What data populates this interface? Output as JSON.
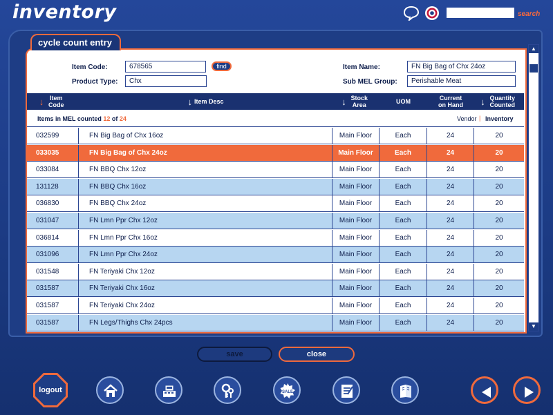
{
  "app": {
    "title": "inventory",
    "search": {
      "value": "",
      "link_label": "search"
    },
    "icons": [
      "help-bubble-icon",
      "target-icon"
    ]
  },
  "panel": {
    "tab_label": "cycle count entry"
  },
  "form": {
    "item_code_label": "Item Code:",
    "item_code_value": "678565",
    "find_label": "find",
    "product_type_label": "Product Type:",
    "product_type_value": "Chx",
    "item_name_label": "Item Name:",
    "item_name_value": "FN Big Bag of Chx 24oz",
    "sub_mel_group_label": "Sub MEL Group:",
    "sub_mel_group_value": "Perishable Meat"
  },
  "table": {
    "headers": {
      "item_code": "Item Code",
      "item_desc": "Item Desc",
      "stock_area": "Stock Area",
      "uom": "UOM",
      "current_on_hand": "Current on Hand",
      "quantity_counted": "Quantity Counted"
    },
    "summary": {
      "prefix": "Items in MEL counted",
      "counted": "12",
      "of_word": "of",
      "total": "24"
    },
    "toggle": {
      "vendor": "Vendor",
      "separator": "|",
      "inventory": "Inventory"
    },
    "rows": [
      {
        "code": "032599",
        "desc": "FN Big Bag of Chx 16oz",
        "area": "Main Floor",
        "uom": "Each",
        "on_hand": "24",
        "counted": "20",
        "style": "white"
      },
      {
        "code": "033035",
        "desc": "FN Big Bag of Chx 24oz",
        "area": "Main Floor",
        "uom": "Each",
        "on_hand": "24",
        "counted": "20",
        "style": "selected"
      },
      {
        "code": "033084",
        "desc": "FN BBQ Chx 12oz",
        "area": "Main Floor",
        "uom": "Each",
        "on_hand": "24",
        "counted": "20",
        "style": "white"
      },
      {
        "code": "131128",
        "desc": "FN BBQ Chx 16oz",
        "area": "Main Floor",
        "uom": "Each",
        "on_hand": "24",
        "counted": "20",
        "style": "blue"
      },
      {
        "code": "036830",
        "desc": "FN BBQ Chx 24oz",
        "area": "Main Floor",
        "uom": "Each",
        "on_hand": "24",
        "counted": "20",
        "style": "white"
      },
      {
        "code": "031047",
        "desc": "FN Lmn Ppr Chx 12oz",
        "area": "Main Floor",
        "uom": "Each",
        "on_hand": "24",
        "counted": "20",
        "style": "blue"
      },
      {
        "code": "036814",
        "desc": "FN Lmn Ppr Chx 16oz",
        "area": "Main Floor",
        "uom": "Each",
        "on_hand": "24",
        "counted": "20",
        "style": "white"
      },
      {
        "code": "031096",
        "desc": "FN Lmn Ppr Chx 24oz",
        "area": "Main Floor",
        "uom": "Each",
        "on_hand": "24",
        "counted": "20",
        "style": "blue"
      },
      {
        "code": "031548",
        "desc": "FN Teriyaki Chx 12oz",
        "area": "Main Floor",
        "uom": "Each",
        "on_hand": "24",
        "counted": "20",
        "style": "white"
      },
      {
        "code": "031587",
        "desc": "FN Teriyaki Chx 16oz",
        "area": "Main Floor",
        "uom": "Each",
        "on_hand": "24",
        "counted": "20",
        "style": "blue"
      },
      {
        "code": "031587",
        "desc": "FN Teriyaki Chx 24oz",
        "area": "Main Floor",
        "uom": "Each",
        "on_hand": "24",
        "counted": "20",
        "style": "white"
      },
      {
        "code": "031587",
        "desc": "FN Legs/Thighs Chx 24pcs",
        "area": "Main Floor",
        "uom": "Each",
        "on_hand": "24",
        "counted": "20",
        "style": "blue"
      }
    ]
  },
  "actions": {
    "save_label": "save",
    "close_label": "close"
  },
  "bottom_nav": {
    "logout_label": "logout",
    "icons": [
      "home-icon",
      "register-icon",
      "keys-icon",
      "sale-badge-icon",
      "checklist-icon",
      "book-icon",
      "previous-arrow-icon",
      "next-arrow-icon"
    ]
  },
  "colors": {
    "background": "#1d3a7e",
    "accent": "#f06a3c",
    "row_blue": "#b7d6f1",
    "header": "#1a3170"
  }
}
